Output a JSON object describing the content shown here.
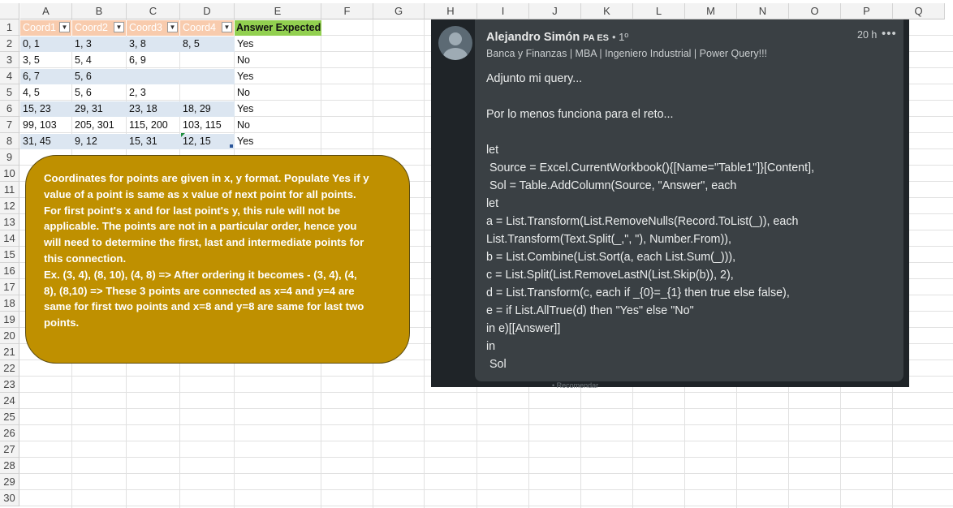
{
  "sheet": {
    "columns": [
      "A",
      "B",
      "C",
      "D",
      "E",
      "F",
      "G",
      "H",
      "I",
      "J",
      "K",
      "L",
      "M",
      "N",
      "O",
      "P",
      "Q"
    ],
    "rows": [
      "1",
      "2",
      "3",
      "4",
      "5",
      "6",
      "7",
      "8",
      "9",
      "10",
      "11",
      "12",
      "13",
      "14",
      "15",
      "16",
      "17",
      "18",
      "19",
      "20",
      "21",
      "22",
      "23",
      "24",
      "25",
      "26",
      "27",
      "28",
      "29",
      "30"
    ],
    "table_headers": [
      "Coord1",
      "Coord2",
      "Coord3",
      "Coord4"
    ],
    "answer_header": "Answer Expected",
    "data": [
      [
        "0, 1",
        "1, 3",
        "3, 8",
        "8, 5",
        "Yes"
      ],
      [
        "3, 5",
        "5, 4",
        "6, 9",
        "",
        "No"
      ],
      [
        "6, 7",
        "5, 6",
        "",
        "",
        "Yes"
      ],
      [
        "4, 5",
        "5, 6",
        "2, 3",
        "",
        "No"
      ],
      [
        "15, 23",
        "29, 31",
        "23, 18",
        "18, 29",
        "Yes"
      ],
      [
        "99, 103",
        "205, 301",
        "115, 200",
        "103, 115",
        "No"
      ],
      [
        "31, 45",
        "9, 12",
        "15, 31",
        "12, 15",
        "Yes"
      ]
    ],
    "colors": {
      "header_fill": "#f8cbad",
      "band_fill": "#dce6f1",
      "answer_fill": "#92d050"
    }
  },
  "callout": {
    "lines": [
      "Coordinates for points are given in x, y format. Populate Yes if y",
      "value of a point is same as x value of next point for all points.",
      "For first point's x  and for last point's y, this rule will not be",
      "applicable. The points are not in a particular order, hence you",
      "will need to determine the first, last and intermediate points for",
      "this connection.",
      "Ex. (3, 4), (8, 10), (4, 8) => After ordering it becomes - (3, 4), (4,",
      "8), (8,10) => These 3 points are connected as x=4 and y=4 are",
      "same for first two points and x=8 and y=8 are same for last two",
      "points."
    ],
    "color": "#bf9000"
  },
  "comment": {
    "author": "Alejandro Simón",
    "badge": "PA ES",
    "degree": "• 1º",
    "headline": "Banca y Finanzas | MBA | Ingeniero Industrial | Power Query!!!",
    "time": "20 h",
    "more_icon": "more-horizontal-icon",
    "body_lines": [
      "Adjunto mi query...",
      "",
      "Por lo menos funciona para el reto...",
      "",
      "let",
      " Source = Excel.CurrentWorkbook(){[Name=\"Table1\"]}[Content],",
      " Sol = Table.AddColumn(Source, \"Answer\", each",
      "let",
      "a = List.Transform(List.RemoveNulls(Record.ToList(_)), each",
      "List.Transform(Text.Split(_,\", \"), Number.From)),",
      "b = List.Combine(List.Sort(a, each List.Sum(_))),",
      "c = List.Split(List.RemoveLastN(List.Skip(b)), 2),",
      "d = List.Transform(c, each if _{0}=_{1} then true else false),",
      "e = if List.AllTrue(d) then \"Yes\" else \"No\"",
      "in e)[[Answer]]",
      "in",
      " Sol"
    ],
    "react_hint": "• Recomendar",
    "colors": {
      "panel": "#1f2428",
      "card": "#3a4044",
      "text": "#eceeee"
    }
  }
}
